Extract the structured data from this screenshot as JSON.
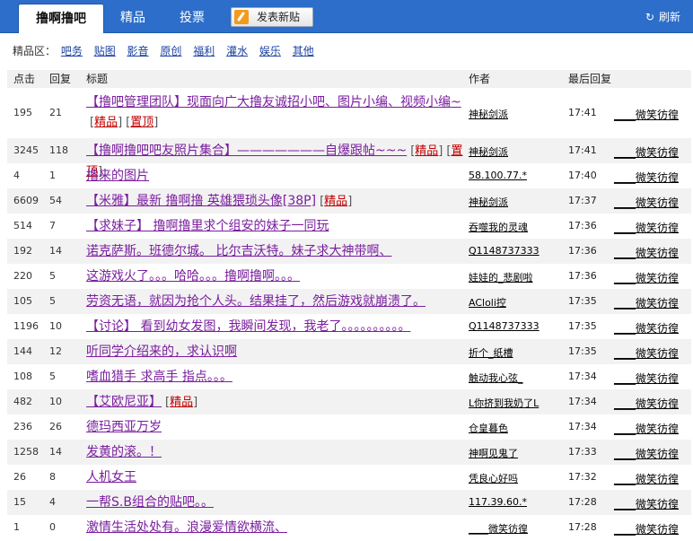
{
  "tabs": [
    {
      "label": "撸啊撸吧"
    },
    {
      "label": "精品"
    },
    {
      "label": "投票"
    }
  ],
  "post_button": "发表新贴",
  "refresh": "刷新",
  "category_label": "精品区：",
  "categories": [
    "吧务",
    "贴图",
    "影音",
    "原创",
    "福利",
    "灌水",
    "娱乐",
    "其他"
  ],
  "columns": {
    "clicks": "点击",
    "replies": "回复",
    "title": "标题",
    "author": "作者",
    "last_reply": "最后回复"
  },
  "threads": [
    {
      "clicks": "195",
      "replies": "21",
      "title": "【撸吧管理团队】现面向广大撸友诚招小吧、图片小编、视频小编~",
      "tags": [
        "精品",
        "置顶"
      ],
      "author": "神秘剑派",
      "time": "17:41",
      "last": "____微笑彷徨"
    },
    {
      "clicks": "3245",
      "replies": "118",
      "title": "【撸啊撸吧吧友照片集合】———————自爆跟帖~~~",
      "tags": [
        "精品",
        "置顶"
      ],
      "author": "神秘剑派",
      "time": "17:41",
      "last": "____微笑彷徨"
    },
    {
      "clicks": "4",
      "replies": "1",
      "title": "撸来的图片",
      "tags": [],
      "author": "58.100.77.*",
      "time": "17:40",
      "last": "____微笑彷徨"
    },
    {
      "clicks": "6609",
      "replies": "54",
      "title": "【米雅】最新 撸啊撸 英雄猥琐头像[38P]",
      "tags": [
        "精品"
      ],
      "author": "神秘剑派",
      "time": "17:37",
      "last": "____微笑彷徨"
    },
    {
      "clicks": "514",
      "replies": "7",
      "title": "【求妹子】 撸啊撸里求个组安的妹子一同玩",
      "tags": [],
      "author": "吞噬我的灵魂",
      "time": "17:36",
      "last": "____微笑彷徨"
    },
    {
      "clicks": "192",
      "replies": "14",
      "title": "诺克萨斯。班德尔城。 比尔吉沃特。妹子求大神带啊、",
      "tags": [],
      "author": "Q1148737333",
      "time": "17:36",
      "last": "____微笑彷徨"
    },
    {
      "clicks": "220",
      "replies": "5",
      "title": "这游戏火了。。。哈哈。。。撸啊撸啊。。。",
      "tags": [],
      "author": "娃娃的_悲剧啦",
      "time": "17:36",
      "last": "____微笑彷徨"
    },
    {
      "clicks": "105",
      "replies": "5",
      "title": "劳资无语，就因为抢个人头。结果挂了，然后游戏就崩溃了。",
      "tags": [],
      "author": "ACloli控",
      "time": "17:35",
      "last": "____微笑彷徨"
    },
    {
      "clicks": "1196",
      "replies": "10",
      "title": "【讨论】 看到幼女发图，我瞬间发现，我老了。。。。。。。。。。",
      "tags": [],
      "author": "Q1148737333",
      "time": "17:35",
      "last": "____微笑彷徨"
    },
    {
      "clicks": "144",
      "replies": "12",
      "title": "听同学介绍来的，求认识啊",
      "tags": [],
      "author": "折个_纸槽",
      "time": "17:35",
      "last": "____微笑彷徨"
    },
    {
      "clicks": "108",
      "replies": "5",
      "title": "嗜血猎手 求高手 指点。。。",
      "tags": [],
      "author": "触动我心弦_",
      "time": "17:34",
      "last": "____微笑彷徨"
    },
    {
      "clicks": "482",
      "replies": "10",
      "title": "【艾欧尼亚】",
      "tags": [
        "精品"
      ],
      "author": "L你挤到我奶了L",
      "time": "17:34",
      "last": "____微笑彷徨"
    },
    {
      "clicks": "236",
      "replies": "26",
      "title": "德玛西亚万岁",
      "tags": [],
      "author": "仓皇暮色",
      "time": "17:34",
      "last": "____微笑彷徨"
    },
    {
      "clicks": "1258",
      "replies": "14",
      "title": "发黄的滚。！",
      "tags": [],
      "author": "神啊见鬼了",
      "time": "17:33",
      "last": "____微笑彷徨"
    },
    {
      "clicks": "26",
      "replies": "8",
      "title": "人机女王",
      "tags": [],
      "author": "凭良心好吗",
      "time": "17:32",
      "last": "____微笑彷徨"
    },
    {
      "clicks": "15",
      "replies": "4",
      "title": "一帮S.B组合的贴吧。。",
      "tags": [],
      "author": "117.39.60.*",
      "time": "17:28",
      "last": "____微笑彷徨"
    },
    {
      "clicks": "1",
      "replies": "0",
      "title": "激情生活处处有。浪漫爱情欲横流、",
      "tags": [],
      "author": "____微笑彷徨",
      "time": "17:28",
      "last": "____微笑彷徨"
    }
  ],
  "colors": {
    "topbar": "#2c6ec9",
    "title": "#7a1e9e",
    "tag": "#c00000",
    "link": "#1d43a0"
  }
}
